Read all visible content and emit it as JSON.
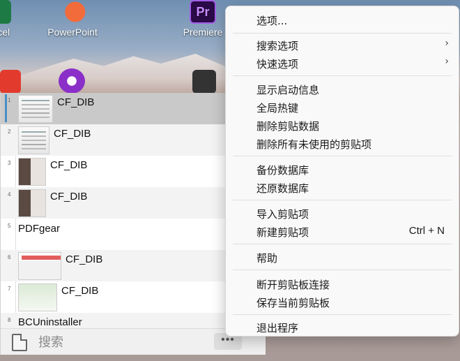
{
  "desktop": {
    "icons": [
      {
        "label": "Excel",
        "icon": "excel-icon"
      },
      {
        "label": "PowerPoint",
        "icon": "powerpoint-icon"
      },
      {
        "label": "Premiere",
        "icon": "premiere-icon"
      }
    ],
    "premiere_glyph": "Pr"
  },
  "clipboard": {
    "items": [
      {
        "num": "1",
        "text": "CF_DIB"
      },
      {
        "num": "2",
        "text": "CF_DIB"
      },
      {
        "num": "3",
        "text": "CF_DIB"
      },
      {
        "num": "4",
        "text": "CF_DIB"
      },
      {
        "num": "5",
        "text": "PDFgear"
      },
      {
        "num": "6",
        "text": "CF_DIB"
      },
      {
        "num": "7",
        "text": "CF_DIB"
      },
      {
        "num": "8",
        "text": "BCUninstaller"
      }
    ],
    "search_placeholder": "搜索",
    "more_label": "•••"
  },
  "menu": {
    "options": "选项...",
    "search_options": "搜索选项",
    "quick_options": "快速选项",
    "show_startup": "显示启动信息",
    "global_hotkeys": "全局热键",
    "delete_clip_data": "删除剪贴数据",
    "delete_unused": "删除所有未使用的剪贴项",
    "backup_db": "备份数据库",
    "restore_db": "还原数据库",
    "import_clip": "导入剪贴项",
    "new_clip": "新建剪贴项",
    "new_clip_shortcut": "Ctrl + N",
    "help": "帮助",
    "disconnect": "断开剪贴板连接",
    "save_current": "保存当前剪贴板",
    "exit": "退出程序",
    "submenu_arrow": "›"
  },
  "colors": {
    "selection_bar": "#4a8ec4",
    "selected_row": "#c9c9c9",
    "menu_bg": "#f9f9f9"
  }
}
